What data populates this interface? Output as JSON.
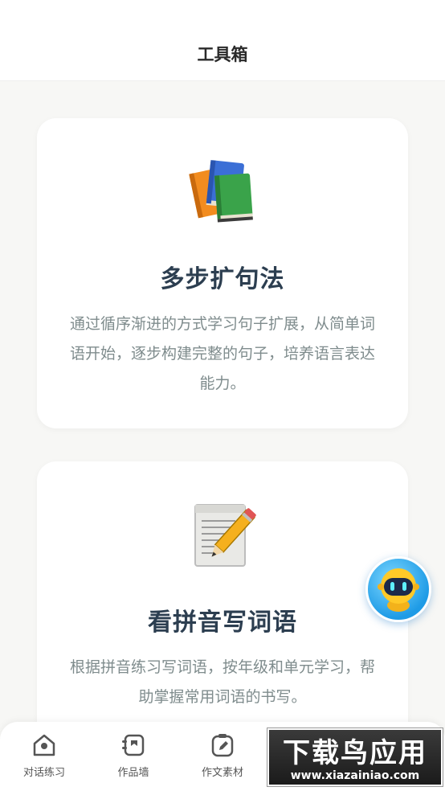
{
  "header": {
    "title": "工具箱"
  },
  "cards": [
    {
      "title": "多步扩句法",
      "description": "通过循序渐进的方式学习句子扩展，从简单词语开始，逐步构建完整的句子，培养语言表达能力。",
      "icon": "books-icon"
    },
    {
      "title": "看拼音写词语",
      "description": "根据拼音练习写词语，按年级和单元学习，帮助掌握常用词语的书写。",
      "icon": "notepad-pencil-icon"
    }
  ],
  "assistant": {
    "icon": "robot-icon"
  },
  "bottom_nav": {
    "items": [
      {
        "label": "对话练习",
        "icon": "chat-practice-icon"
      },
      {
        "label": "作品墙",
        "icon": "gallery-wall-icon"
      },
      {
        "label": "作文素材",
        "icon": "essay-material-icon"
      }
    ]
  },
  "watermark": {
    "title": "下载鸟应用",
    "url": "www.xiazainiao.com"
  },
  "colors": {
    "title": "#2c3e50",
    "description": "#7f8c8d",
    "background": "#f7f7f5",
    "accent": "#1e9be6"
  }
}
